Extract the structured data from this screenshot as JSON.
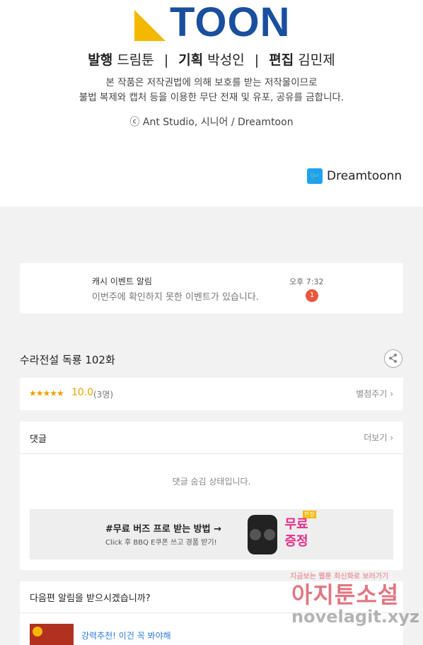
{
  "header": {
    "logo_text": "TOON",
    "credits": {
      "publisher_label": "발행",
      "publisher": "드림툰",
      "planner_label": "기획",
      "planner": "박성인",
      "editor_label": "편집",
      "editor": "김민제",
      "separator": "|"
    },
    "notice_line1": "본 작품은 저작권법에 의해 보호를 받는 저작물이므로",
    "notice_line2": "불법 복제와 캡처 등을 이용한 무단 전재 및 유포, 공유를 금합니다.",
    "copyright": "ⓒ Ant Studio, 시니어 / Dreamtoon",
    "twitter_handle": "Dreamtoonn"
  },
  "notification": {
    "title": "캐시 이벤트 알림",
    "message": "이번주에 확인하지 못한 이벤트가 있습니다.",
    "time": "오후 7:32",
    "badge_count": "1"
  },
  "episode": {
    "title": "수라전설 독룡 102화"
  },
  "rating": {
    "stars": "★★★★★",
    "score": "10.0",
    "count": "(3명)",
    "rate_link": "별점주기",
    "score_value": 10.0
  },
  "comments": {
    "title": "댓글",
    "more": "더보기",
    "hidden_message": "댓글 숨김 상태입니다.",
    "ad": {
      "title": "#무료 버즈 프로 받는 방법 →",
      "subtitle": "Click 후 BBQ E쿠폰 쓰고 경품 받기!",
      "badge_line1": "무료",
      "badge_line2": "증정",
      "tag": "한정"
    }
  },
  "next_episode": {
    "title": "다음편 알림을 받으시겠습니까?",
    "recommend_link": "강력추천! 이건 꼭 봐야해"
  },
  "watermark": {
    "small": "지금보는 웹툰 최신화로 보러가기",
    "big": "아지툰소설",
    "url": "novelagit.xyz"
  },
  "colors": {
    "brand_blue": "#1a4f9e",
    "brand_yellow": "#f5b800",
    "star": "#f0a000",
    "badge_red": "#e8573d",
    "link_blue": "#2a7bd6"
  }
}
